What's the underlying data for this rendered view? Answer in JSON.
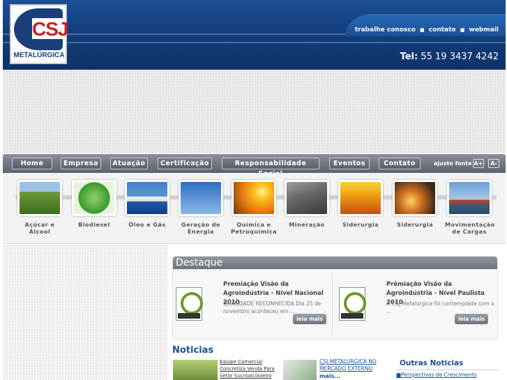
{
  "header": {
    "logo_text": "CSJ",
    "logo_subtitle": "METALÚRGICA",
    "links": [
      "trabalhe conosco",
      "contato",
      "webmail"
    ],
    "phone_label": "Tel:",
    "phone": "55 19 3437 4242"
  },
  "nav": {
    "items": [
      "Home",
      "Empresa",
      "Atuação",
      "Certificação",
      "Responsabilidade Social",
      "Eventos",
      "Contato"
    ],
    "font_label": "ajuste fonte",
    "font_increase": "A+",
    "font_decrease": "A-"
  },
  "sectors": [
    {
      "label": "Açúcar e Álcool",
      "icon": "sugarcane-field-photo"
    },
    {
      "label": "Biodiesel",
      "icon": "biodiesel-logo"
    },
    {
      "label": "Óleo e Gás",
      "icon": "oil-platform-photo"
    },
    {
      "label": "Geração de Energia",
      "icon": "wind-turbine-photo"
    },
    {
      "label": "Química e Petroquímica",
      "icon": "refinery-sunset-photo"
    },
    {
      "label": "Mineração",
      "icon": "mining-photo"
    },
    {
      "label": "Siderurgia",
      "icon": "molten-steel-photo"
    },
    {
      "label": "Siderurgia",
      "icon": "steel-worker-photo"
    },
    {
      "label": "Movimentação de Cargas",
      "icon": "port-crane-photo"
    }
  ],
  "destaque": {
    "title": "Destaque",
    "items": [
      {
        "title": "Premiação Visão da Agroindústria - Nível Nacional 2010",
        "body": "QUALIDADE RECONHECIDA Dia 25 de novembro aconteceu em ...",
        "button": "leia mais"
      },
      {
        "title": "Prêmiação Visão da Agroindústria - Nível Paulista 2010",
        "body": "A CSJ Metalurgica foi contemplada com o ...",
        "button": "leia mais"
      }
    ]
  },
  "noticias": {
    "title": "Noticias",
    "item1": "Equipe Comercial Concretiza Venda Para Setor Sucroalcooleiro",
    "item2": "CSJ METALÚRGICA NO MERCADO EXTERNO",
    "more": "mais...",
    "outras_title": "Outras Noticias",
    "outras_item": "Perspectivas de Crescimento"
  },
  "colors": {
    "brand_blue": "#123d7d",
    "brand_red": "#c8202c",
    "nav_gray": "#5c626d"
  }
}
